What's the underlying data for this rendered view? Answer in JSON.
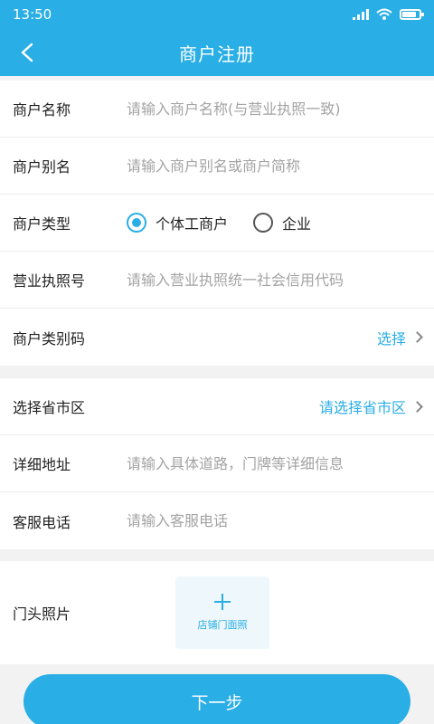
{
  "status_bar": {
    "time": "13:50"
  },
  "nav": {
    "title": "商户注册"
  },
  "form": {
    "merchant_name": {
      "label": "商户名称",
      "placeholder": "请输入商户名称(与营业执照一致)"
    },
    "merchant_alias": {
      "label": "商户别名",
      "placeholder": "请输入商户别名或商户简称"
    },
    "merchant_type": {
      "label": "商户类型",
      "options": [
        {
          "label": "个体工商户",
          "selected": true
        },
        {
          "label": "企业",
          "selected": false
        }
      ]
    },
    "license_no": {
      "label": "营业执照号",
      "placeholder": "请输入营业执照统一社会信用代码"
    },
    "category_code": {
      "label": "商户类别码",
      "action": "选择"
    },
    "region": {
      "label": "选择省市区",
      "action": "请选择省市区"
    },
    "address": {
      "label": "详细地址",
      "placeholder": "请输入具体道路，门牌等详细信息"
    },
    "service_phone": {
      "label": "客服电话",
      "placeholder": "请输入客服电话"
    },
    "store_photo": {
      "label": "门头照片",
      "upload_text": "店铺门面照"
    }
  },
  "footer": {
    "next_label": "下一步"
  },
  "colors": {
    "primary": "#29aee6",
    "background": "#f2f2f2",
    "placeholder": "#a3a3a3"
  }
}
